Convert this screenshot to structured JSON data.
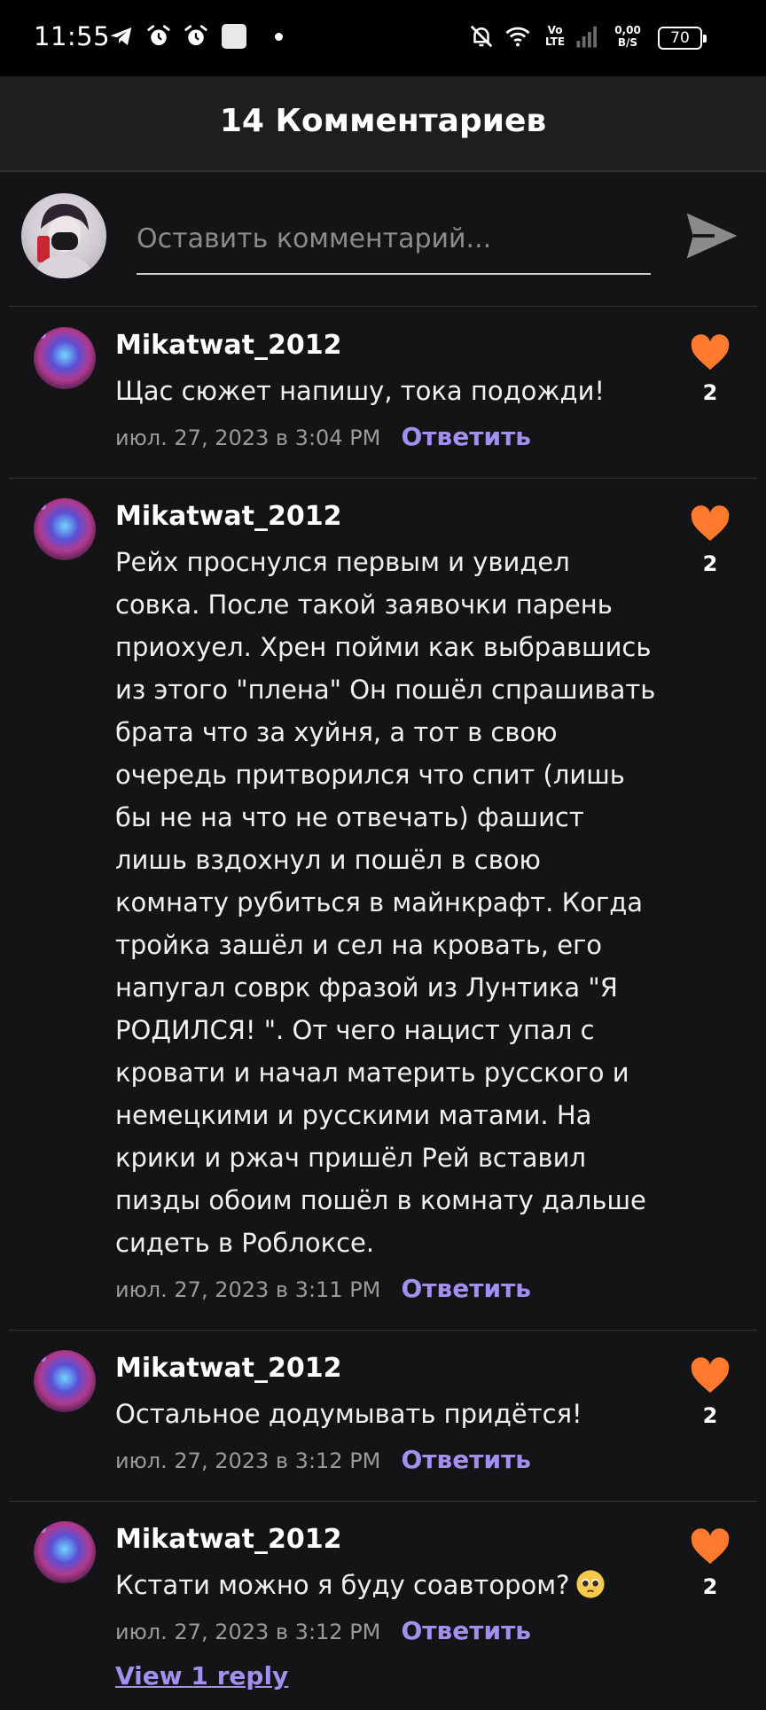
{
  "status_bar": {
    "time": "11:55",
    "volte_top": "Vo",
    "volte_bottom": "LTE",
    "net_speed_value": "0,00",
    "net_speed_unit": "B/S",
    "battery": "70"
  },
  "header": {
    "title": "14 Комментариев"
  },
  "compose": {
    "placeholder": "Оставить комментарий..."
  },
  "comments": [
    {
      "author": "Mikatwat_2012",
      "text": "Щас сюжет напишу, тока подожди!",
      "time": "июл. 27, 2023 в 3:04 PM",
      "reply_label": "Ответить",
      "likes": "2"
    },
    {
      "author": "Mikatwat_2012",
      "text": "Рейх проснулся первым и увидел совка. После такой заявочки парень приохуел. Хрен пойми как выбравшись из этого \"плена\" Он пошёл спрашивать брата что за хуйня, а тот в свою очередь притворился что спит (лишь бы не на что не отвечать) фашист лишь вздохнул и пошёл в свою комнату рубиться в майнкрафт. Когда тройка зашёл и сел на кровать, его напугал соврк фразой из Лунтика \"Я РОДИЛСЯ! \". От чего нацист упал с кровати и начал материть русского и немецкими и русскими матами. На крики и ржач пришёл Рей вставил пизды обоим пошёл в комнату дальше сидеть в Роблоксе.",
      "time": "июл. 27, 2023 в 3:11 PM",
      "reply_label": "Ответить",
      "likes": "2"
    },
    {
      "author": "Mikatwat_2012",
      "text": "Остальное додумывать придётся!",
      "time": "июл. 27, 2023 в 3:12 PM",
      "reply_label": "Ответить",
      "likes": "2"
    },
    {
      "author": "Mikatwat_2012",
      "text": "Кстати можно я буду соавтором?",
      "emoji": "pleading-face-emoji",
      "time": "июл. 27, 2023 в 3:12 PM",
      "reply_label": "Ответить",
      "likes": "2",
      "view_replies": "View 1 reply"
    }
  ],
  "colors": {
    "background": "#141416",
    "header": "#1e1e20",
    "like_heart": "#ff7a2f",
    "reply_link": "#a28ff0",
    "timestamp": "#9a9a9a"
  },
  "icons": {
    "send": "send-icon",
    "like": "heart-icon",
    "status_left": [
      "telegram-icon",
      "alarm-icon",
      "alarm-icon",
      "notification-square-icon",
      "dot-icon"
    ],
    "status_right": [
      "mute-bell-icon",
      "wifi-icon",
      "signal-icon",
      "battery-icon"
    ]
  }
}
